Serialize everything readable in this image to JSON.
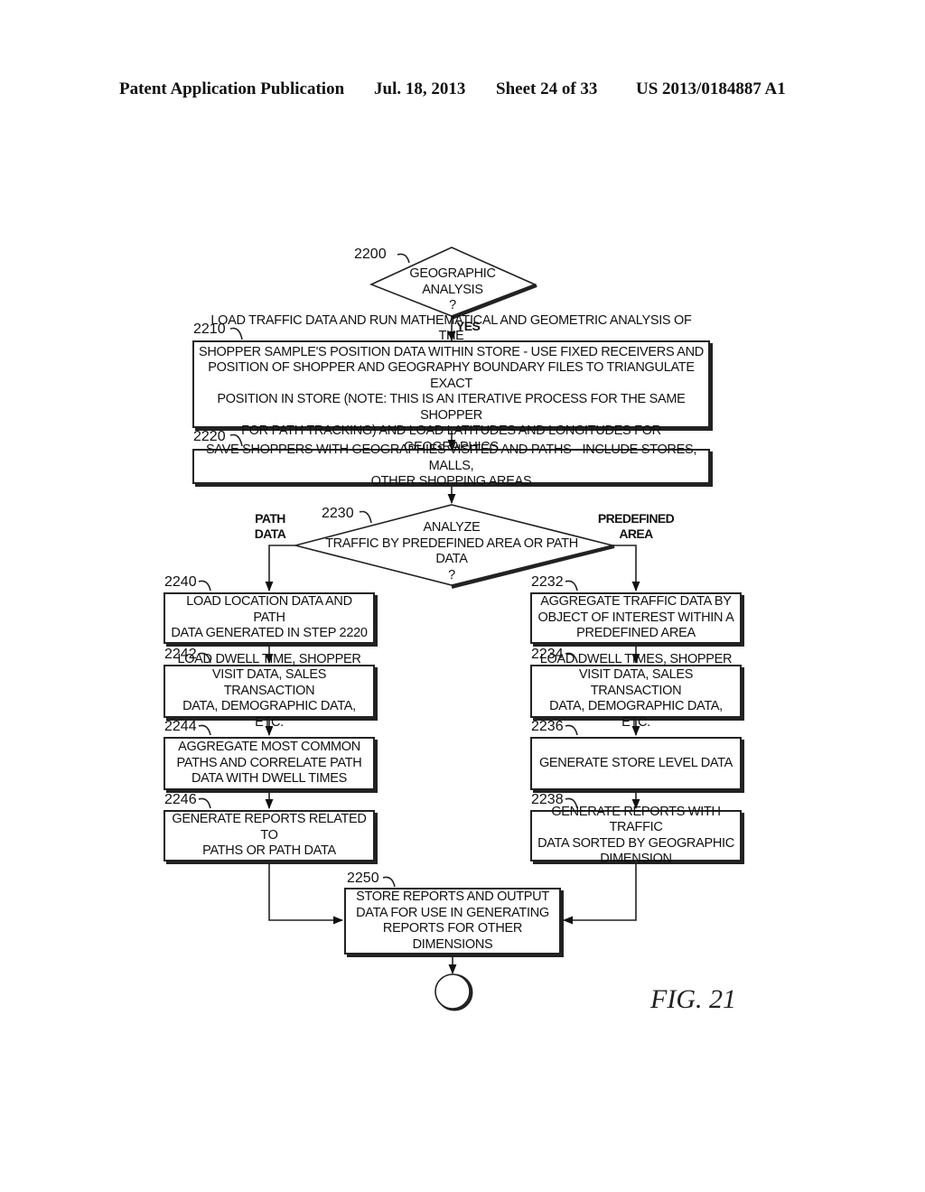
{
  "header": {
    "publication": "Patent Application Publication",
    "date": "Jul. 18, 2013",
    "sheet": "Sheet 24 of 33",
    "number": "US 2013/0184887 A1"
  },
  "figure_label": "FIG. 21",
  "nodes": {
    "n2200": {
      "ref": "2200",
      "type": "decision",
      "text": "GEOGRAPHIC\nANALYSIS\n?"
    },
    "n2210": {
      "ref": "2210",
      "type": "process",
      "text": "LOAD TRAFFIC DATA AND RUN MATHEMATICAL AND GEOMETRIC ANALYSIS OF THE\nSHOPPER SAMPLE'S POSITION DATA WITHIN STORE - USE FIXED RECEIVERS AND\nPOSITION OF SHOPPER AND GEOGRAPHY BOUNDARY FILES TO TRIANGULATE EXACT\nPOSITION IN STORE (NOTE: THIS IS AN ITERATIVE PROCESS FOR THE SAME SHOPPER\nFOR PATH TRACKING) AND LOAD LATITUDES AND LONGITUDES FOR GEOGRAPHICS"
    },
    "n2220": {
      "ref": "2220",
      "type": "process",
      "text": "SAVE SHOPPERS WITH GEOGRAPHIES VISITED AND PATHS - INCLUDE STORES, MALLS,\nOTHER SHOPPING AREAS"
    },
    "n2230": {
      "ref": "2230",
      "type": "decision",
      "text": "ANALYZE\nTRAFFIC BY PREDEFINED AREA OR PATH\nDATA\n?"
    },
    "n2240": {
      "ref": "2240",
      "type": "process",
      "text": "LOAD LOCATION DATA AND PATH\nDATA GENERATED IN STEP 2220"
    },
    "n2242": {
      "ref": "2242",
      "type": "process",
      "text": "LOAD DWELL TIME, SHOPPER\nVISIT DATA, SALES TRANSACTION\nDATA, DEMOGRAPHIC DATA, ETC."
    },
    "n2244": {
      "ref": "2244",
      "type": "process",
      "text": "AGGREGATE MOST COMMON\nPATHS AND CORRELATE PATH\nDATA WITH DWELL TIMES"
    },
    "n2246": {
      "ref": "2246",
      "type": "process",
      "text": "GENERATE REPORTS RELATED TO\nPATHS OR PATH DATA"
    },
    "n2232": {
      "ref": "2232",
      "type": "process",
      "text": "AGGREGATE TRAFFIC DATA BY\nOBJECT OF INTEREST WITHIN A\nPREDEFINED AREA"
    },
    "n2234": {
      "ref": "2234",
      "type": "process",
      "text": "LOAD DWELL TIMES, SHOPPER\nVISIT DATA, SALES TRANSACTION\nDATA, DEMOGRAPHIC DATA, ETC."
    },
    "n2236": {
      "ref": "2236",
      "type": "process",
      "text": "GENERATE STORE LEVEL DATA"
    },
    "n2238": {
      "ref": "2238",
      "type": "process",
      "text": "GENERATE REPORTS WITH TRAFFIC\nDATA SORTED BY GEOGRAPHIC\nDIMENSION"
    },
    "n2250": {
      "ref": "2250",
      "type": "process",
      "text": "STORE REPORTS AND OUTPUT\nDATA FOR USE IN GENERATING\nREPORTS FOR OTHER DIMENSIONS"
    },
    "end": {
      "type": "terminator",
      "text": ""
    }
  },
  "edge_labels": {
    "yes": "YES",
    "path_data": "PATH\nDATA",
    "predefined_area": "PREDEFINED\nAREA"
  },
  "edges": [
    {
      "from": "2200",
      "to": "2210",
      "label": "YES"
    },
    {
      "from": "2210",
      "to": "2220"
    },
    {
      "from": "2220",
      "to": "2230"
    },
    {
      "from": "2230",
      "to": "2240",
      "label": "PATH DATA"
    },
    {
      "from": "2230",
      "to": "2232",
      "label": "PREDEFINED AREA"
    },
    {
      "from": "2240",
      "to": "2242"
    },
    {
      "from": "2242",
      "to": "2244"
    },
    {
      "from": "2244",
      "to": "2246"
    },
    {
      "from": "2232",
      "to": "2234"
    },
    {
      "from": "2234",
      "to": "2236"
    },
    {
      "from": "2236",
      "to": "2238"
    },
    {
      "from": "2246",
      "to": "2250"
    },
    {
      "from": "2238",
      "to": "2250"
    },
    {
      "from": "2250",
      "to": "end"
    }
  ]
}
